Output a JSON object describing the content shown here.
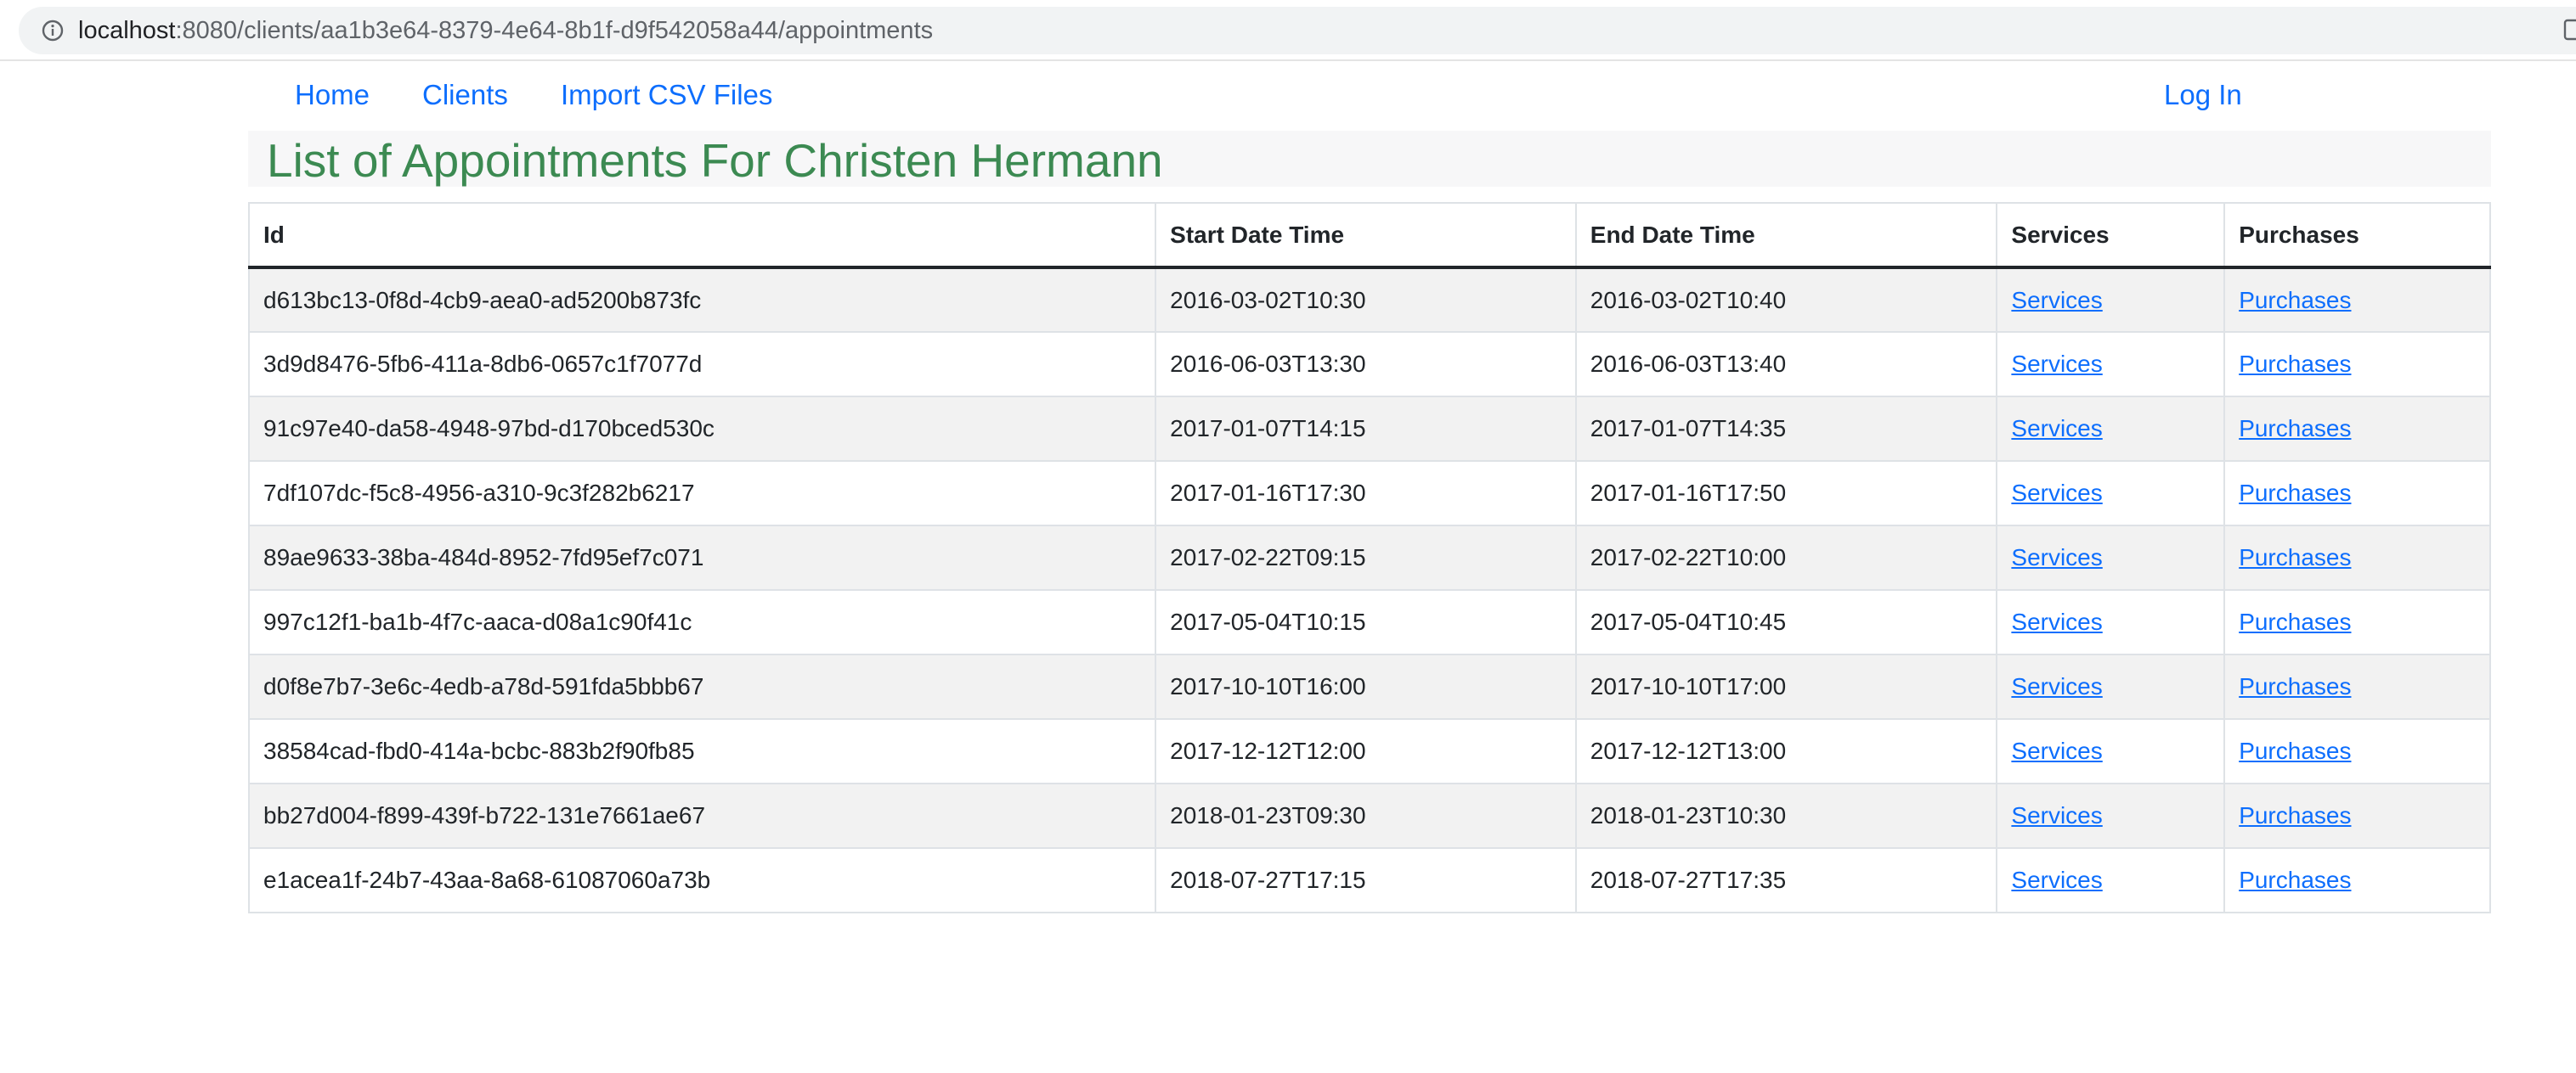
{
  "browser": {
    "url_host": "localhost",
    "url_rest": ":8080/clients/aa1b3e64-8379-4e64-8b1f-d9f542058a44/appointments",
    "info_icon": "info-icon",
    "extension_icon": "extension-icon"
  },
  "nav": {
    "home": "Home",
    "clients": "Clients",
    "import": "Import CSV Files",
    "login": "Log In"
  },
  "page": {
    "title": "List of Appointments For Christen Hermann"
  },
  "table": {
    "headers": {
      "id": "Id",
      "start": "Start Date Time",
      "end": "End Date Time",
      "services": "Services",
      "purchases": "Purchases"
    },
    "rows": [
      {
        "id": "d613bc13-0f8d-4cb9-aea0-ad5200b873fc",
        "start": "2016-03-02T10:30",
        "end": "2016-03-02T10:40",
        "services": "Services",
        "purchases": "Purchases"
      },
      {
        "id": "3d9d8476-5fb6-411a-8db6-0657c1f7077d",
        "start": "2016-06-03T13:30",
        "end": "2016-06-03T13:40",
        "services": "Services",
        "purchases": "Purchases"
      },
      {
        "id": "91c97e40-da58-4948-97bd-d170bced530c",
        "start": "2017-01-07T14:15",
        "end": "2017-01-07T14:35",
        "services": "Services",
        "purchases": "Purchases"
      },
      {
        "id": "7df107dc-f5c8-4956-a310-9c3f282b6217",
        "start": "2017-01-16T17:30",
        "end": "2017-01-16T17:50",
        "services": "Services",
        "purchases": "Purchases"
      },
      {
        "id": "89ae9633-38ba-484d-8952-7fd95ef7c071",
        "start": "2017-02-22T09:15",
        "end": "2017-02-22T10:00",
        "services": "Services",
        "purchases": "Purchases"
      },
      {
        "id": "997c12f1-ba1b-4f7c-aaca-d08a1c90f41c",
        "start": "2017-05-04T10:15",
        "end": "2017-05-04T10:45",
        "services": "Services",
        "purchases": "Purchases"
      },
      {
        "id": "d0f8e7b7-3e6c-4edb-a78d-591fda5bbb67",
        "start": "2017-10-10T16:00",
        "end": "2017-10-10T17:00",
        "services": "Services",
        "purchases": "Purchases"
      },
      {
        "id": "38584cad-fbd0-414a-bcbc-883b2f90fb85",
        "start": "2017-12-12T12:00",
        "end": "2017-12-12T13:00",
        "services": "Services",
        "purchases": "Purchases"
      },
      {
        "id": "bb27d004-f899-439f-b722-131e7661ae67",
        "start": "2018-01-23T09:30",
        "end": "2018-01-23T10:30",
        "services": "Services",
        "purchases": "Purchases"
      },
      {
        "id": "e1acea1f-24b7-43aa-8a68-61087060a73b",
        "start": "2018-07-27T17:15",
        "end": "2018-07-27T17:35",
        "services": "Services",
        "purchases": "Purchases"
      }
    ]
  },
  "colors": {
    "link": "#0d6efd",
    "title": "#3c8a52",
    "stripe": "#f2f2f2"
  }
}
